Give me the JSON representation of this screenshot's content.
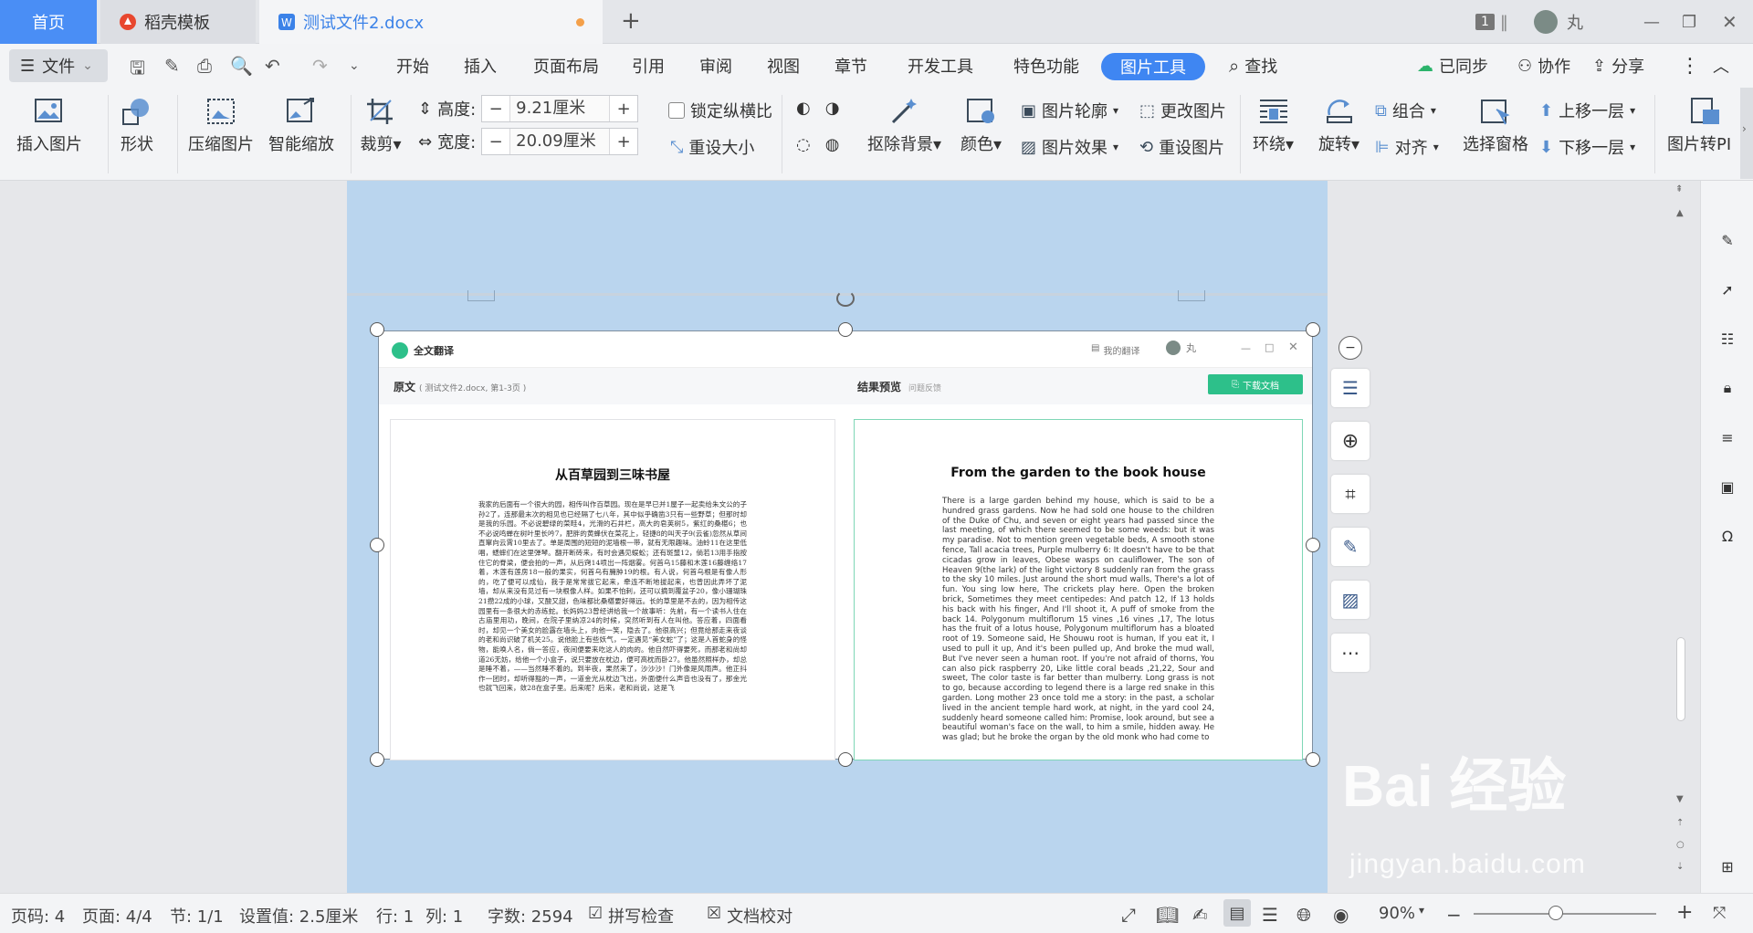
{
  "tabs": {
    "home": "首页",
    "template": "稻壳模板",
    "doc": "测试文件2.docx",
    "page_badge": "1",
    "user": "丸"
  },
  "menu": {
    "file": "文件",
    "items": [
      "开始",
      "插入",
      "页面布局",
      "引用",
      "审阅",
      "视图",
      "章节",
      "开发工具",
      "特色功能"
    ],
    "active": "图片工具",
    "search": "查找",
    "synced": "已同步",
    "collab": "协作",
    "share": "分享"
  },
  "ribbon": {
    "insert_image": "插入图片",
    "shape": "形状",
    "compress": "压缩图片",
    "smart_zoom": "智能缩放",
    "crop": "裁剪",
    "height_label": "高度:",
    "height_value": "9.21厘米",
    "width_label": "宽度:",
    "width_value": "20.09厘米",
    "lock_ratio": "锁定纵横比",
    "reset_size": "重设大小",
    "remove_bg": "抠除背景",
    "color": "颜色",
    "outline": "图片轮廓",
    "effect": "图片效果",
    "change": "更改图片",
    "reset_image": "重设图片",
    "wrap": "环绕",
    "rotate": "旋转",
    "group": "组合",
    "align": "对齐",
    "select_pane": "选择窗格",
    "bring_forward": "上移一层",
    "send_backward": "下移一层",
    "to_pdf": "图片转PI"
  },
  "embedded": {
    "app_name": "全文翻译",
    "my_translation": "我的翻译",
    "user": "丸",
    "source_label": "原文",
    "source_meta": "( 测试文件2.docx, 第1-3页 )",
    "result_label": "结果预览",
    "feedback": "问题反馈",
    "download": "下载文档",
    "zh_title": "从百草园到三味书屋",
    "zh_text": "我家的后面有一个很大的园，相传叫作百草园。现在是早已并1屋子一起卖给朱文公的子孙2了，连那最末次的相见也已经隔了七八年，其中似乎确凿3只有一些野草；但那时却是我的乐园。不必说碧绿的菜畦4，光滑的石井栏，高大的皂荚树5，紫红的桑椹6；也不必说鸣蝉在树叶里长吟7，肥胖的黄蜂伏在菜花上，轻捷8的叫天子9(云雀)忽然从草间直窜向云霄10里去了。单是周围的短短的泥墙根一带，就有无限趣味。油蛉11在这里低唱，蟋蟀们在这里弹琴。翻开断砖来，有时会遇见蜈蚣；还有斑蝥12，倘若13用手指按住它的脊梁，便会拍的一声，从后窍14喷出一阵烟雾。何首乌15藤和木莲16藤缠络17着，木莲有莲房18一般的果实，何首乌有臃肿19的根。有人说，何首乌根是有像人形的，吃了便可以成仙，我于是常常拔它起来，牵连不断地拔起来，也曾因此弄坏了泥墙，却从来没有见过有一块根像人样。如果不怕刺，还可以摘到覆盆子20，像小珊瑚珠21攒22成的小球，又酸又甜，色味都比桑椹要好得远。长的草里是不去的，因为相传这园里有一条很大的赤练蛇。长妈妈23曾经讲给我一个故事听：先前，有一个读书人住在古庙里用功，晚间，在院子里纳凉24的时候，突然听到有人在叫他。答应着，四面看时，却见一个美女的脸露在墙头上，向他一笑，隐去了。他很高兴；但竟给那走来夜谈的老和尚识破了机关25。说他脸上有些妖气，一定遇见“美女蛇”了；这是人首蛇身的怪物，能唤人名，倘一答应，夜间便要来吃这人的肉的。他自然吓得要死，而那老和尚却道26无妨，给他一个小盒子，说只要放在枕边，便可高枕而卧27。他虽然照样办，却总是睡不着，——当然睡不着的。到半夜，果然来了，沙沙沙！门外像是风雨声。他正抖作一团时，却听得豁的一声，一道金光从枕边飞出，外面便什么声音也没有了，那金光也就飞回来，敛28在盒子里。后来呢？后来，老和尚说，这是飞",
    "en_title": "From the garden to the book house",
    "en_text": "There is a large garden behind my house, which is said to be a hundred grass gardens. Now he had sold one house to the children of the Duke of Chu, and seven or eight years had passed since the last meeting, of which there seemed to be some weeds: but it was my paradise. Not to mention green vegetable beds, A smooth stone fence, Tall acacia trees, Purple mulberry 6: It doesn't have to be that cicadas grow in leaves, Obese wasps on cauliflower, The son of Heaven 9(the lark) of the light victory 8 suddenly ran from the grass to the sky 10 miles. Just around the short mud walls, There's a lot of fun. You sing low here, The crickets play here. Open the broken brick, Sometimes they meet centipedes: And patch 12, If 13 holds his back with his finger, And I'll shoot it, A puff of smoke from the back 14. Polygonum multiflorum 15 vines ,16 vines ,17, The lotus has the fruit of a lotus house, Polygonum multiflorum has a bloated root of 19. Someone said, He Shouwu root is human, If you eat it, I used to pull it up, And it's been pulled up, And broke the mud wall, But I've never seen a human root. If you're not afraid of thorns, You can also pick raspberry 20, Like little coral beads ,21,22, Sour and sweet, The color taste is far better than mulberry. Long grass is not to go, because according to legend there is a large red snake in this garden. Long mother 23 once told me a story: in the past, a scholar lived in the ancient temple hard work, at night, in the yard cool 24, suddenly heard someone called him: Promise, look around, but see a beautiful woman's face on the wall, to him a smile, hidden away. He was glad; but he broke the organ by the old monk who had come to"
  },
  "status": {
    "page_num": "页码: 4",
    "pages": "页面: 4/4",
    "section": "节: 1/1",
    "setting": "设置值: 2.5厘米",
    "row": "行: 1",
    "col": "列: 1",
    "words": "字数: 2594",
    "spell": "拼写检查",
    "proof": "文档校对",
    "zoom": "90%"
  },
  "watermark": {
    "brand": "Bai 经验",
    "url": "jingyan.baidu.com"
  },
  "colors": {
    "accent": "#3f86f2",
    "page_bg": "#bad5ee",
    "download_green": "#2dc08a"
  }
}
